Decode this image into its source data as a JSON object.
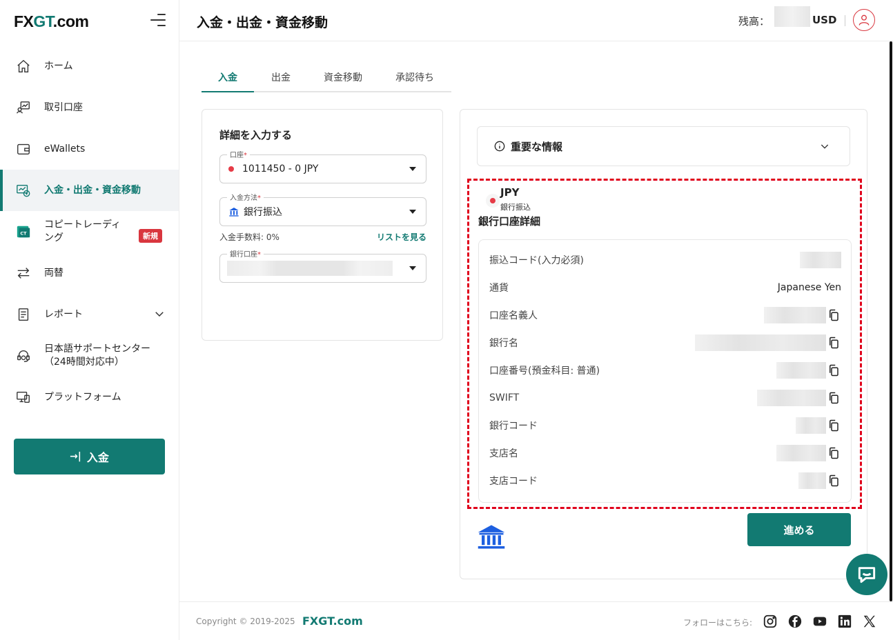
{
  "sidebar": {
    "logo_left": "FX",
    "logo_gt": "GT",
    "logo_right": ".com",
    "items": [
      {
        "label": "ホーム",
        "icon": "home-icon"
      },
      {
        "label": "取引口座",
        "icon": "trading-account-icon"
      },
      {
        "label": "eWallets",
        "icon": "wallet-icon"
      },
      {
        "label": "入金・出金・資金移動",
        "icon": "funds-icon"
      },
      {
        "label": "コピートレーディング",
        "icon": "copy-trading-icon",
        "badge": "新規"
      },
      {
        "label": "両替",
        "icon": "exchange-icon"
      },
      {
        "label": "レポート",
        "icon": "report-icon"
      },
      {
        "label": "日本語サポートセンター（24時間対応中）",
        "icon": "support-icon"
      },
      {
        "label": "プラットフォーム",
        "icon": "platform-icon"
      }
    ],
    "deposit_button": "入金"
  },
  "header": {
    "title": "入金・出金・資金移動",
    "balance_label": "残高：",
    "currency": "USD"
  },
  "tabs": [
    "入金",
    "出金",
    "資金移動",
    "承認待ち"
  ],
  "form": {
    "title": "詳細を入力する",
    "account_label": "口座",
    "account_value": "1011450 - 0 JPY",
    "method_label": "入金方法",
    "method_value": "銀行振込",
    "fee_text": "入金手数料: 0%",
    "list_link": "リストを見る",
    "bank_account_label": "銀行口座",
    "required_mark": "*"
  },
  "info": {
    "important_title": "重要な情報",
    "currency_code": "JPY",
    "currency_method": "銀行振込",
    "bank_details_title": "銀行口座詳細",
    "rows": [
      {
        "label": "振込コード(入力必須)"
      },
      {
        "label": "通貨",
        "value": "Japanese Yen"
      },
      {
        "label": "口座名義人"
      },
      {
        "label": "銀行名"
      },
      {
        "label": "口座番号(預金科目: 普通)"
      },
      {
        "label": "SWIFT"
      },
      {
        "label": "銀行コード"
      },
      {
        "label": "支店名"
      },
      {
        "label": "支店コード"
      }
    ],
    "proceed_button": "進める"
  },
  "footer": {
    "copyright": "Copyright © 2019-2025",
    "brand": "FXGT.com",
    "follow": "フォローはこちら:"
  },
  "colors": {
    "brand": "#127a72",
    "alert": "#d9363e",
    "highlight": "#e0001b"
  }
}
